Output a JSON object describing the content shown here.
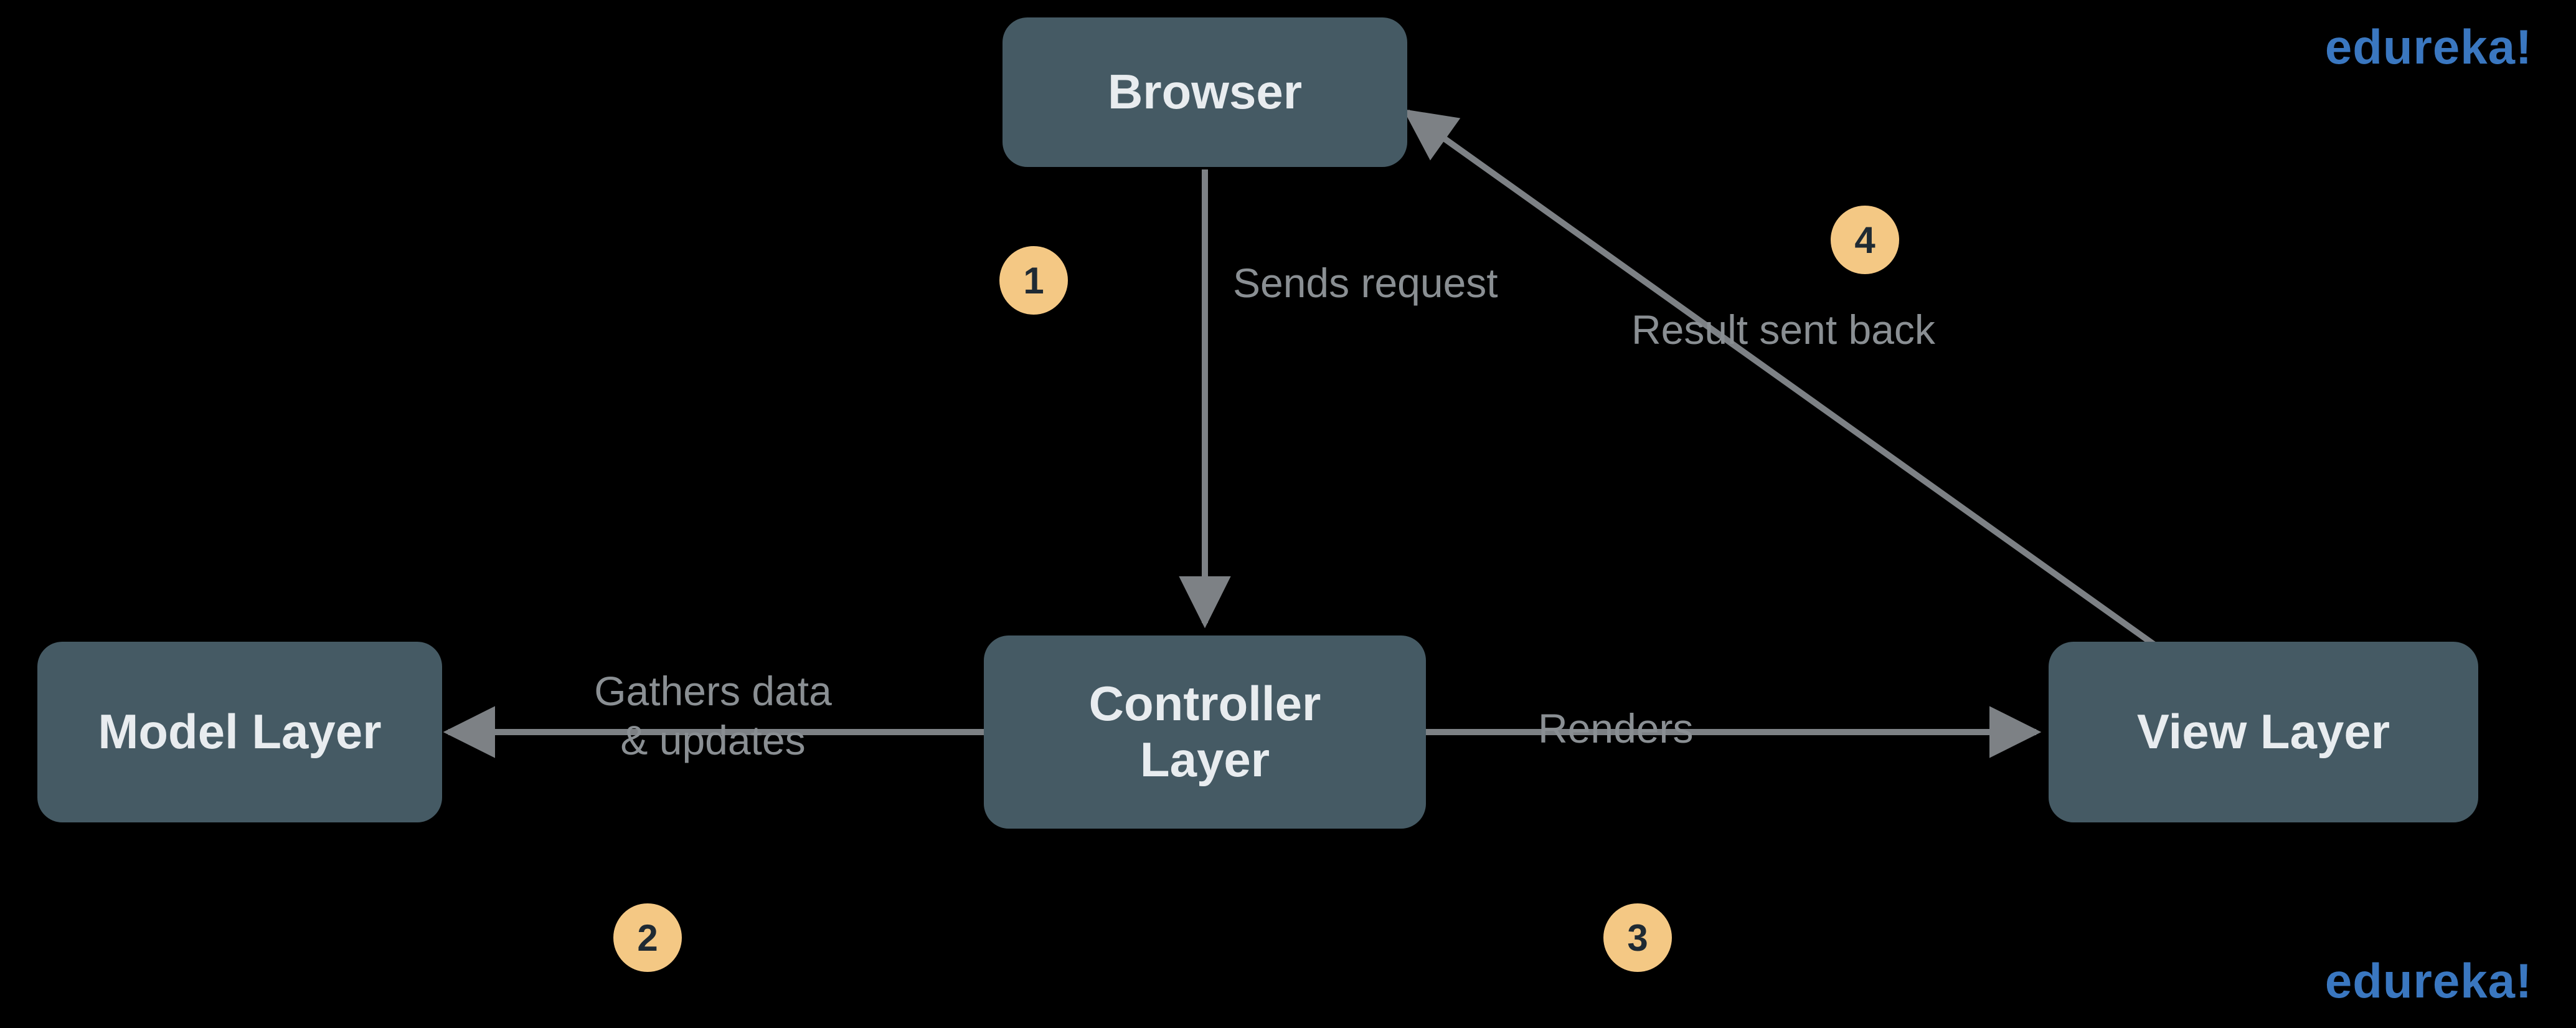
{
  "nodes": {
    "browser": "Browser",
    "controller_l1": "Controller",
    "controller_l2": "Layer",
    "model": "Model Layer",
    "view": "View Layer"
  },
  "steps": {
    "s1": {
      "num": "1",
      "label": "Sends request"
    },
    "s2": {
      "num": "2",
      "label_l1": "Gathers data",
      "label_l2": "& updates"
    },
    "s3": {
      "num": "3",
      "label": "Renders"
    },
    "s4": {
      "num": "4",
      "label": "Result sent back"
    }
  },
  "brand": "edureka!",
  "colors": {
    "node_bg": "#455a64",
    "node_text": "#e8ecef",
    "badge_bg": "#f4c884",
    "badge_text": "#1f2a33",
    "label": "#8a8f93",
    "arrow": "#7d8185",
    "brand": "#3a77c0"
  }
}
